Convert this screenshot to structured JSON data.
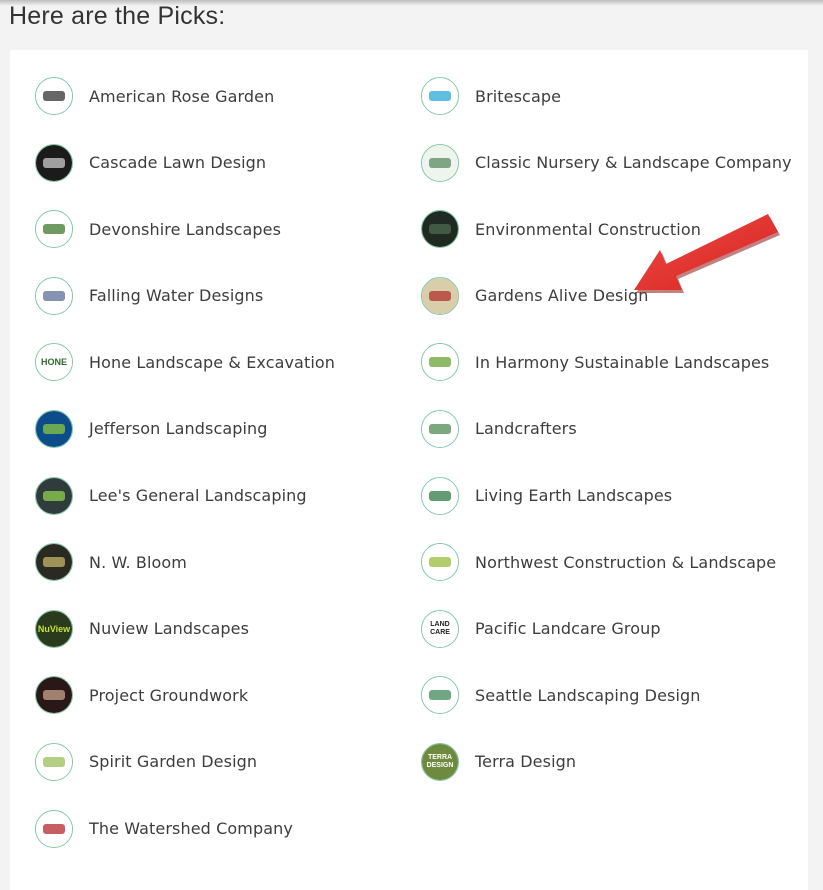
{
  "heading": "Here are the Picks:",
  "picks": [
    {
      "name": "American Rose Garden",
      "logo_bg": "#ffffff",
      "logo_fg": "#333333",
      "logo_text": ""
    },
    {
      "name": "Britescape",
      "logo_bg": "#ffffff",
      "logo_fg": "#29a8d6",
      "logo_text": ""
    },
    {
      "name": "Cascade Lawn Design",
      "logo_bg": "#1b1b1b",
      "logo_fg": "#cccccc",
      "logo_text": ""
    },
    {
      "name": "Classic Nursery & Landscape Company",
      "logo_bg": "#eef5ef",
      "logo_fg": "#5a8a62",
      "logo_text": ""
    },
    {
      "name": "Devonshire Landscapes",
      "logo_bg": "#ffffff",
      "logo_fg": "#3f7a2e",
      "logo_text": ""
    },
    {
      "name": "Environmental Construction",
      "logo_bg": "#1f2a22",
      "logo_fg": "#4d6b4f",
      "logo_text": ""
    },
    {
      "name": "Falling Water Designs",
      "logo_bg": "#ffffff",
      "logo_fg": "#5b6f9a",
      "logo_text": ""
    },
    {
      "name": "Gardens Alive Design",
      "logo_bg": "#d8cfaa",
      "logo_fg": "#b3322c",
      "logo_text": ""
    },
    {
      "name": "Hone Landscape & Excavation",
      "logo_bg": "#ffffff",
      "logo_fg": "#2f6b2f",
      "logo_text": "HONE"
    },
    {
      "name": "In Harmony Sustainable Landscapes",
      "logo_bg": "#ffffff",
      "logo_fg": "#6aa336",
      "logo_text": ""
    },
    {
      "name": "Jefferson Landscaping",
      "logo_bg": "#0d4c8a",
      "logo_fg": "#8cc63f",
      "logo_text": ""
    },
    {
      "name": "Landcrafters",
      "logo_bg": "#ffffff",
      "logo_fg": "#4d8c52",
      "logo_text": ""
    },
    {
      "name": "Lee's General Landscaping",
      "logo_bg": "#2f3b3d",
      "logo_fg": "#8fd14f",
      "logo_text": ""
    },
    {
      "name": "Living Earth Landscapes",
      "logo_bg": "#ffffff",
      "logo_fg": "#2e7a46",
      "logo_text": ""
    },
    {
      "name": "N. W. Bloom",
      "logo_bg": "#2a2a22",
      "logo_fg": "#c6b66a",
      "logo_text": ""
    },
    {
      "name": "Northwest Construction & Landscape",
      "logo_bg": "#ffffff",
      "logo_fg": "#9bbc3a",
      "logo_text": ""
    },
    {
      "name": "Nuview Landscapes",
      "logo_bg": "#2a3a1c",
      "logo_fg": "#c8e03c",
      "logo_text": "NuView"
    },
    {
      "name": "Pacific Landcare Group",
      "logo_bg": "#ffffff",
      "logo_fg": "#222222",
      "logo_text": "LAND CARE"
    },
    {
      "name": "Project Groundwork",
      "logo_bg": "#2a1818",
      "logo_fg": "#c9a38c",
      "logo_text": ""
    },
    {
      "name": "Seattle Landscaping Design",
      "logo_bg": "#ffffff",
      "logo_fg": "#3f8a5a",
      "logo_text": ""
    },
    {
      "name": "Spirit Garden Design",
      "logo_bg": "#ffffff",
      "logo_fg": "#9bbf5a",
      "logo_text": ""
    },
    {
      "name": "Terra Design",
      "logo_bg": "#6e8a3e",
      "logo_fg": "#ffffff",
      "logo_text": "TERRA DESIGN"
    },
    {
      "name": "The Watershed Company",
      "logo_bg": "#ffffff",
      "logo_fg": "#b3282d",
      "logo_text": ""
    }
  ],
  "colors": {
    "page_bg": "#f3f3f3",
    "card_bg": "#ffffff",
    "logo_ring": "#7fc7a4",
    "text": "#3d3d3d",
    "arrow": "#e8312f"
  },
  "annotation": {
    "icon": "red-arrow-icon",
    "points_to": "Gardens Alive Design"
  }
}
